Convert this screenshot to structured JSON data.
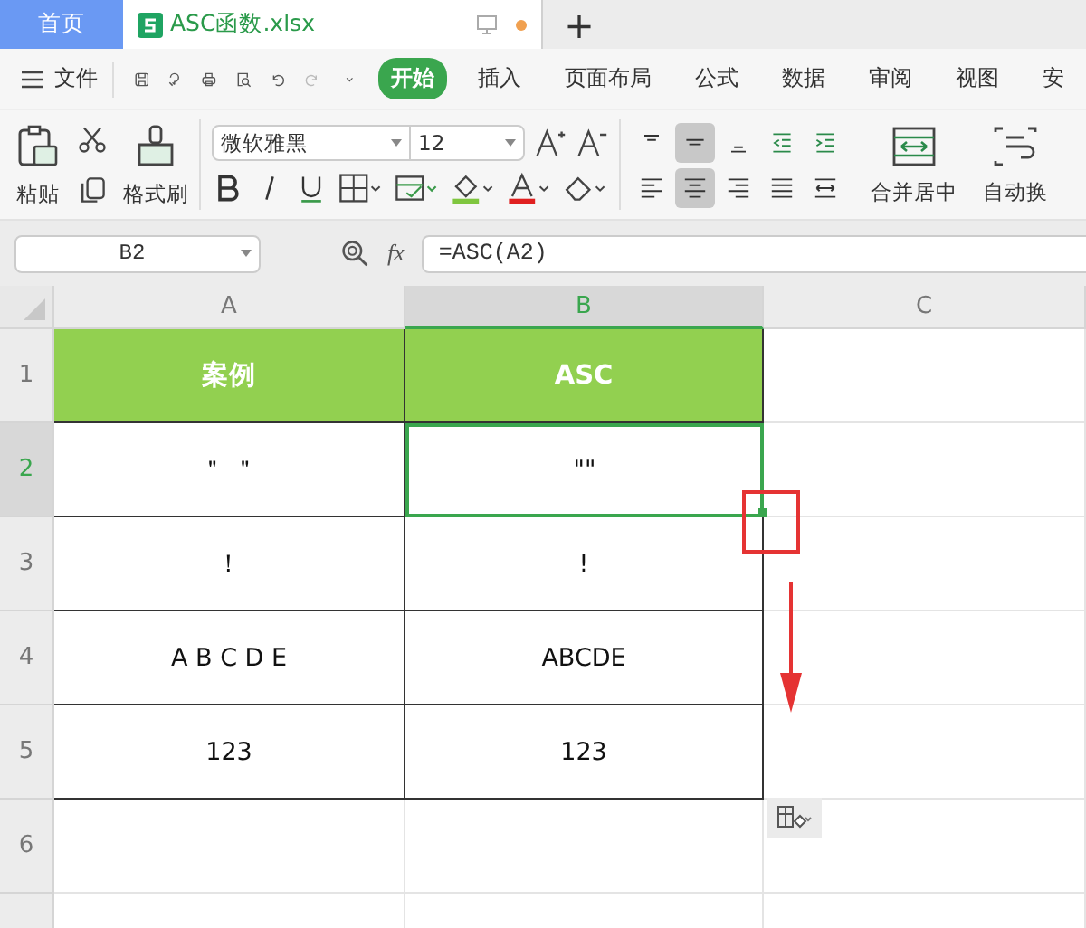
{
  "tabs": [
    {
      "label": "首页",
      "kind": "home",
      "selected": false
    },
    {
      "label": "ASC函数.xlsx",
      "kind": "document",
      "selected": true,
      "modified": true
    }
  ],
  "new_tab": "+",
  "menu": {
    "file": "文件",
    "tabs": [
      {
        "label": "开始",
        "selected": true
      },
      {
        "label": "插入",
        "selected": false
      },
      {
        "label": "页面布局",
        "selected": false
      },
      {
        "label": "公式",
        "selected": false
      },
      {
        "label": "数据",
        "selected": false
      },
      {
        "label": "审阅",
        "selected": false
      },
      {
        "label": "视图",
        "selected": false
      },
      {
        "label": "安",
        "selected": false
      }
    ]
  },
  "ribbon": {
    "paste": "粘贴",
    "format_painter": "格式刷",
    "font": "微软雅黑",
    "font_size": "12",
    "align_top": [
      {
        "kind": "top",
        "selected": false
      },
      {
        "kind": "middle",
        "selected": true
      },
      {
        "kind": "bottom",
        "selected": false
      },
      {
        "kind": "outdent",
        "selected": false
      },
      {
        "kind": "indent",
        "selected": false
      }
    ],
    "align_bottom": [
      {
        "kind": "left",
        "selected": false
      },
      {
        "kind": "center",
        "selected": true
      },
      {
        "kind": "right",
        "selected": false
      },
      {
        "kind": "justify",
        "selected": false
      },
      {
        "kind": "distributed",
        "selected": false
      }
    ],
    "merge": "合并居中",
    "wrap": "自动换"
  },
  "formula_bar": {
    "cell_ref": "B2",
    "fx": "fx",
    "formula": "=ASC(A2)"
  },
  "sheet": {
    "columns": [
      {
        "label": "A",
        "selected": false
      },
      {
        "label": "B",
        "selected": true
      },
      {
        "label": "C",
        "selected": false
      }
    ],
    "rows": [
      {
        "label": "1",
        "kind": "header",
        "selected": false,
        "cells": [
          {
            "text": "案例",
            "selected": false
          },
          {
            "text": "ASC",
            "selected": false
          }
        ]
      },
      {
        "label": "2",
        "kind": "data",
        "selected": true,
        "cells": [
          {
            "text": "＂ ＂",
            "selected": false
          },
          {
            "text": "\"\"",
            "selected": true
          }
        ]
      },
      {
        "label": "3",
        "kind": "data",
        "selected": false,
        "cells": [
          {
            "text": "！",
            "selected": false
          },
          {
            "text": "!",
            "selected": false
          }
        ]
      },
      {
        "label": "4",
        "kind": "data",
        "selected": false,
        "cells": [
          {
            "text": "A B C D E",
            "selected": false
          },
          {
            "text": "ABCDE",
            "selected": false
          }
        ]
      },
      {
        "label": "5",
        "kind": "data",
        "selected": false,
        "cells": [
          {
            "text": "123",
            "selected": false
          },
          {
            "text": "123",
            "selected": false
          }
        ]
      },
      {
        "label": "6",
        "kind": "empty",
        "selected": false,
        "cells": []
      }
    ]
  }
}
